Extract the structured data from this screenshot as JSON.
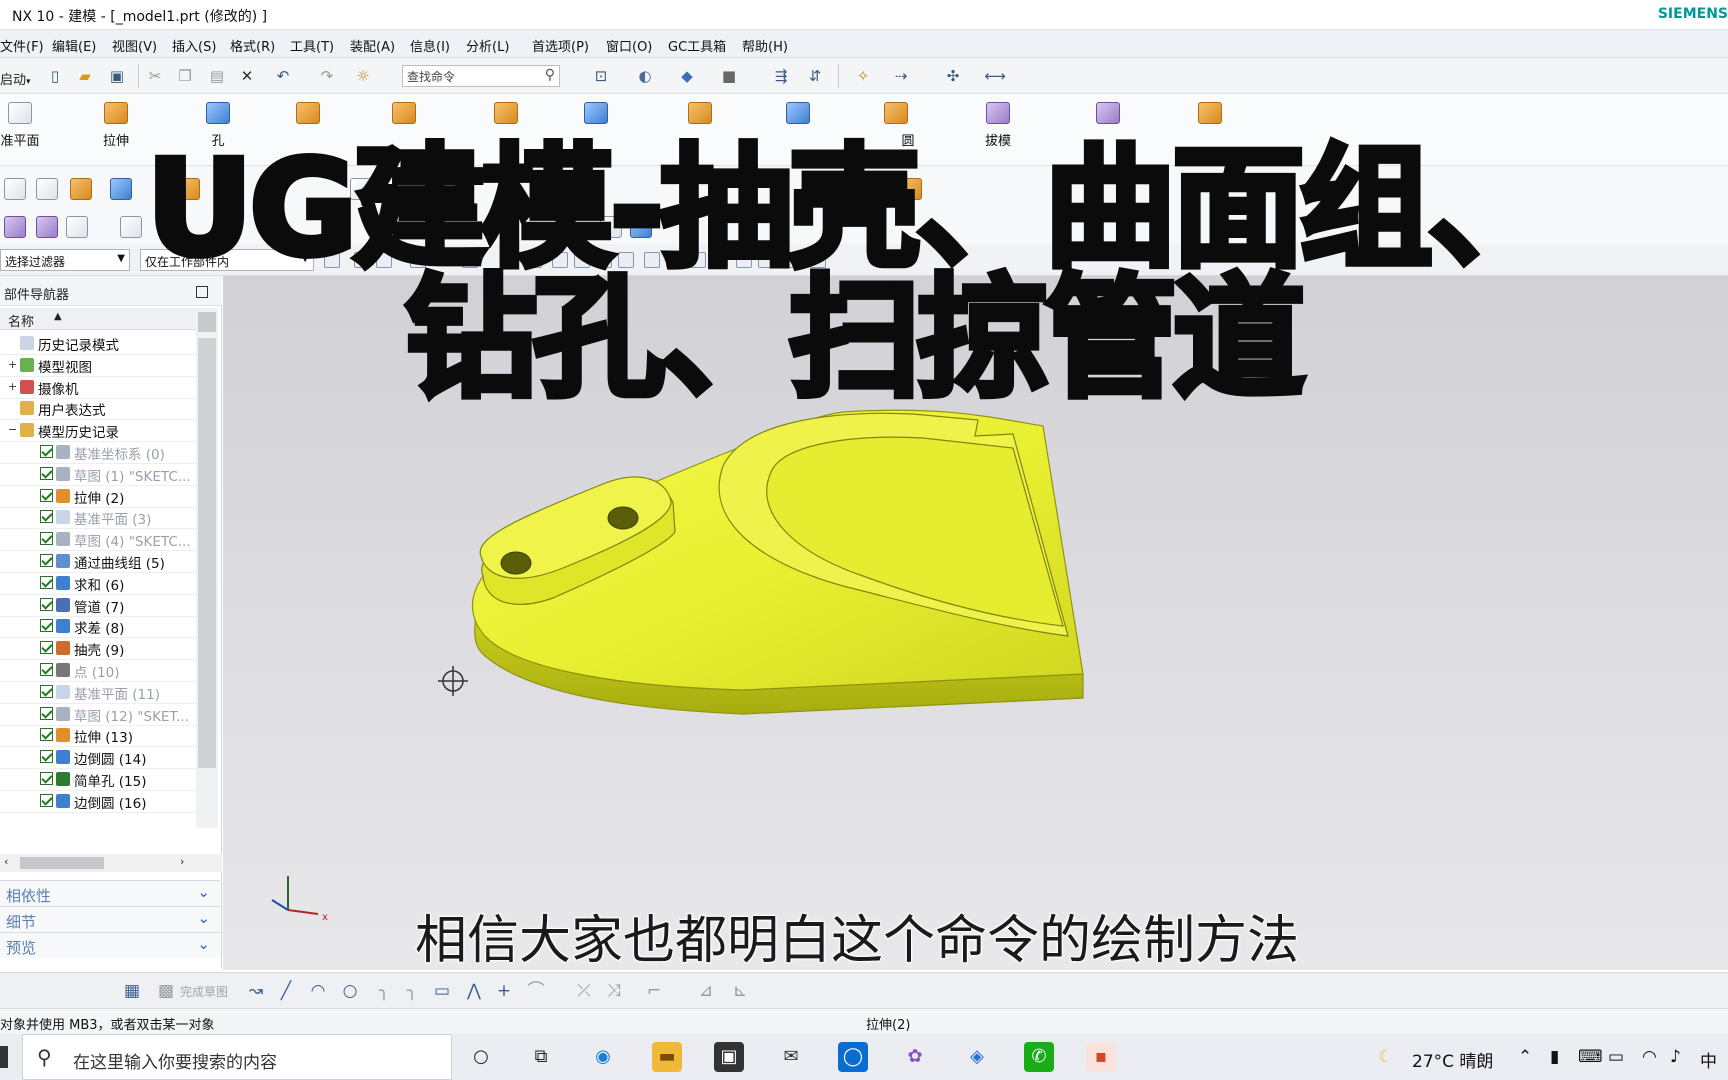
{
  "window": {
    "title": "NX 10 - 建模 - [_model1.prt  (修改的) ]",
    "brand": "SIEMENS"
  },
  "menu": [
    "文件(F)",
    "编辑(E)",
    "视图(V)",
    "插入(S)",
    "格式(R)",
    "工具(T)",
    "装配(A)",
    "信息(I)",
    "分析(L)",
    "首选项(P)",
    "窗口(O)",
    "GC工具箱",
    "帮助(H)"
  ],
  "quickbar": {
    "start_label": "启动",
    "search_placeholder": "查找命令"
  },
  "ribbon": {
    "datum_plane": "准平面",
    "extrude": "拉伸",
    "hole": "孔",
    "draft": "拔模",
    "edge_blend": "圆"
  },
  "filters": {
    "selection_filter": "选择过滤器",
    "scope": "仅在工作部件内"
  },
  "navigator": {
    "title": "部件导航器",
    "column_name": "名称",
    "nodes": [
      {
        "label": "历史记录模式",
        "dim": false
      },
      {
        "label": "模型视图",
        "dim": false
      },
      {
        "label": "摄像机",
        "dim": false
      },
      {
        "label": "用户表达式",
        "dim": false
      },
      {
        "label": "模型历史记录",
        "dim": false
      },
      {
        "label": "基准坐标系 (0)",
        "dim": true
      },
      {
        "label": "草图 (1) \"SKETC...",
        "dim": true
      },
      {
        "label": "拉伸 (2)",
        "dim": false
      },
      {
        "label": "基准平面 (3)",
        "dim": true
      },
      {
        "label": "草图 (4) \"SKETC...",
        "dim": true
      },
      {
        "label": "通过曲线组 (5)",
        "dim": false
      },
      {
        "label": "求和 (6)",
        "dim": false
      },
      {
        "label": "管道 (7)",
        "dim": false
      },
      {
        "label": "求差 (8)",
        "dim": false
      },
      {
        "label": "抽壳 (9)",
        "dim": false
      },
      {
        "label": "点 (10)",
        "dim": true
      },
      {
        "label": "基准平面 (11)",
        "dim": true
      },
      {
        "label": "草图 (12) \"SKET...",
        "dim": true
      },
      {
        "label": "拉伸 (13)",
        "dim": false
      },
      {
        "label": "边倒圆 (14)",
        "dim": false
      },
      {
        "label": "简单孔 (15)",
        "dim": false
      },
      {
        "label": "边倒圆 (16)",
        "dim": false
      }
    ],
    "panels": [
      "相依性",
      "细节",
      "预览"
    ]
  },
  "overlay": {
    "line1": "UG建模-抽壳、曲面组、",
    "line2": "钻孔、扫掠管道",
    "subtitle": "相信大家也都明白这个命令的绘制方法"
  },
  "sketchbar": {
    "finish_sketch": "完成草图"
  },
  "status": {
    "left": "对象并使用 MB3，或者双击某一对象",
    "center": "拉伸(2)"
  },
  "taskbar": {
    "search_placeholder": "在这里输入你要搜索的内容",
    "weather": "27°C  晴朗",
    "ime": "中"
  },
  "colors": {
    "model_yellow": "#e8ef3a",
    "accent": "#009999"
  }
}
